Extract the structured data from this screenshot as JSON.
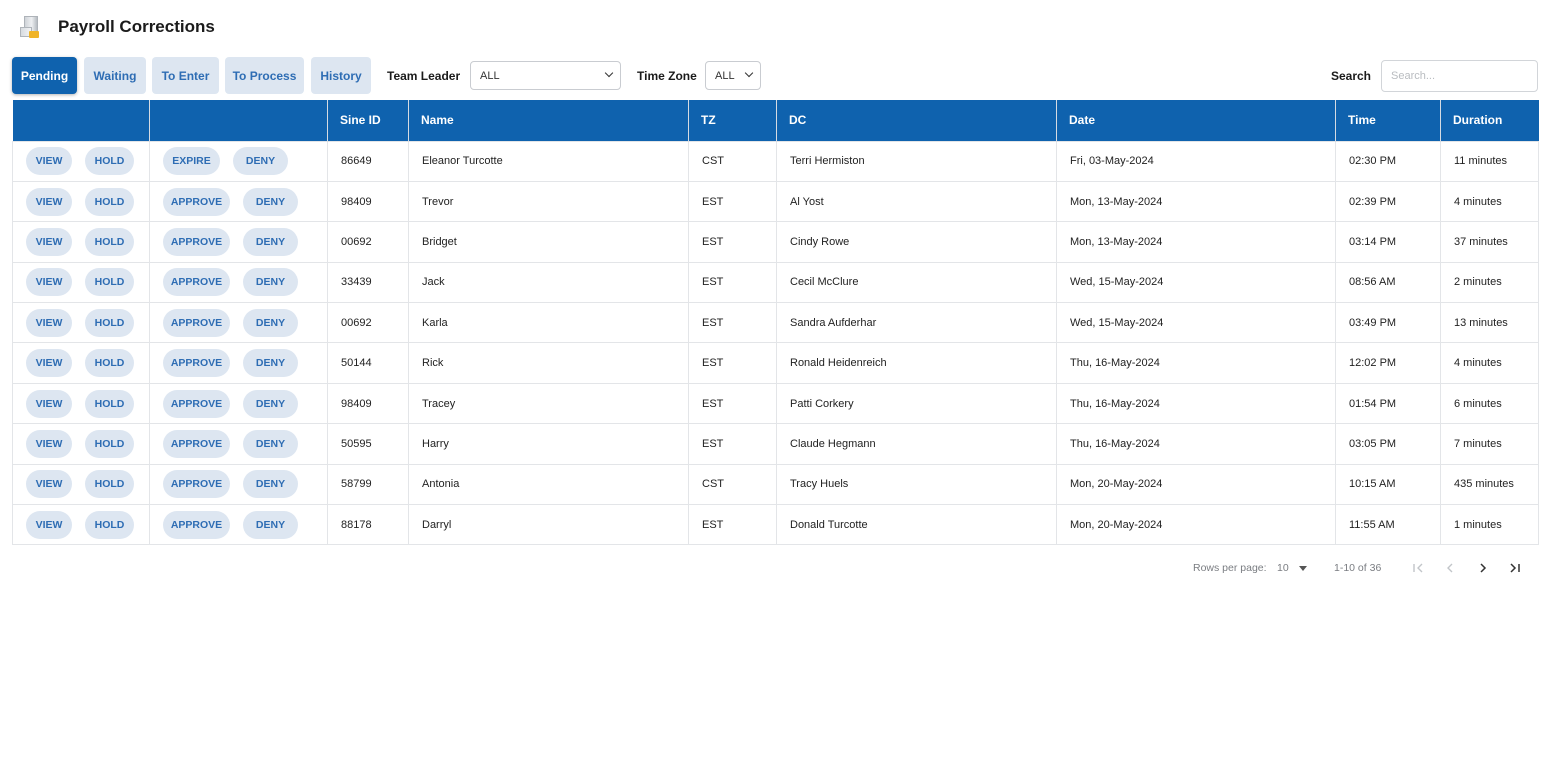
{
  "header": {
    "title": "Payroll Corrections"
  },
  "tabs": [
    {
      "label": "Pending",
      "active": true
    },
    {
      "label": "Waiting",
      "active": false
    },
    {
      "label": "To Enter",
      "active": false
    },
    {
      "label": "To Process",
      "active": false
    },
    {
      "label": "History",
      "active": false
    }
  ],
  "filters": {
    "team_leader_label": "Team Leader",
    "team_leader_value": "ALL",
    "time_zone_label": "Time Zone",
    "time_zone_value": "ALL",
    "search_label": "Search",
    "search_placeholder": "Search..."
  },
  "table": {
    "columns": [
      "",
      "",
      "Sine ID",
      "Name",
      "TZ",
      "DC",
      "Date",
      "Time",
      "Duration"
    ],
    "action_labels": {
      "view": "VIEW",
      "hold": "HOLD",
      "approve": "APPROVE",
      "expire": "EXPIRE",
      "deny": "DENY"
    },
    "rows": [
      {
        "primary_action": "EXPIRE",
        "sine_id": "86649",
        "name": "Eleanor Turcotte",
        "tz": "CST",
        "dc": "Terri Hermiston",
        "date": "Fri, 03-May-2024",
        "time": "02:30 PM",
        "duration": "11 minutes"
      },
      {
        "primary_action": "APPROVE",
        "sine_id": "98409",
        "name": "Trevor",
        "tz": "EST",
        "dc": "Al Yost",
        "date": "Mon, 13-May-2024",
        "time": "02:39 PM",
        "duration": "4 minutes"
      },
      {
        "primary_action": "APPROVE",
        "sine_id": "00692",
        "name": "Bridget",
        "tz": "EST",
        "dc": "Cindy Rowe",
        "date": "Mon, 13-May-2024",
        "time": "03:14 PM",
        "duration": "37 minutes"
      },
      {
        "primary_action": "APPROVE",
        "sine_id": "33439",
        "name": "Jack",
        "tz": "EST",
        "dc": "Cecil McClure",
        "date": "Wed, 15-May-2024",
        "time": "08:56 AM",
        "duration": "2 minutes"
      },
      {
        "primary_action": "APPROVE",
        "sine_id": "00692",
        "name": "Karla",
        "tz": "EST",
        "dc": "Sandra Aufderhar",
        "date": "Wed, 15-May-2024",
        "time": "03:49 PM",
        "duration": "13 minutes"
      },
      {
        "primary_action": "APPROVE",
        "sine_id": "50144",
        "name": "Rick",
        "tz": "EST",
        "dc": "Ronald Heidenreich",
        "date": "Thu, 16-May-2024",
        "time": "12:02 PM",
        "duration": "4 minutes"
      },
      {
        "primary_action": "APPROVE",
        "sine_id": "98409",
        "name": "Tracey",
        "tz": "EST",
        "dc": "Patti Corkery",
        "date": "Thu, 16-May-2024",
        "time": "01:54 PM",
        "duration": "6 minutes"
      },
      {
        "primary_action": "APPROVE",
        "sine_id": "50595",
        "name": "Harry",
        "tz": "EST",
        "dc": "Claude Hegmann",
        "date": "Thu, 16-May-2024",
        "time": "03:05 PM",
        "duration": "7 minutes"
      },
      {
        "primary_action": "APPROVE",
        "sine_id": "58799",
        "name": "Antonia",
        "tz": "CST",
        "dc": "Tracy Huels",
        "date": "Mon, 20-May-2024",
        "time": "10:15 AM",
        "duration": "435 minutes"
      },
      {
        "primary_action": "APPROVE",
        "sine_id": "88178",
        "name": "Darryl",
        "tz": "EST",
        "dc": "Donald Turcotte",
        "date": "Mon, 20-May-2024",
        "time": "11:55 AM",
        "duration": "1 minutes"
      }
    ]
  },
  "pagination": {
    "rows_per_page_label": "Rows per page:",
    "rows_per_page_value": "10",
    "range_text": "1-10 of 36"
  },
  "colors": {
    "accent": "#0f62ae",
    "pill_bg": "#dde6f1",
    "pill_text": "#2e6db4"
  }
}
